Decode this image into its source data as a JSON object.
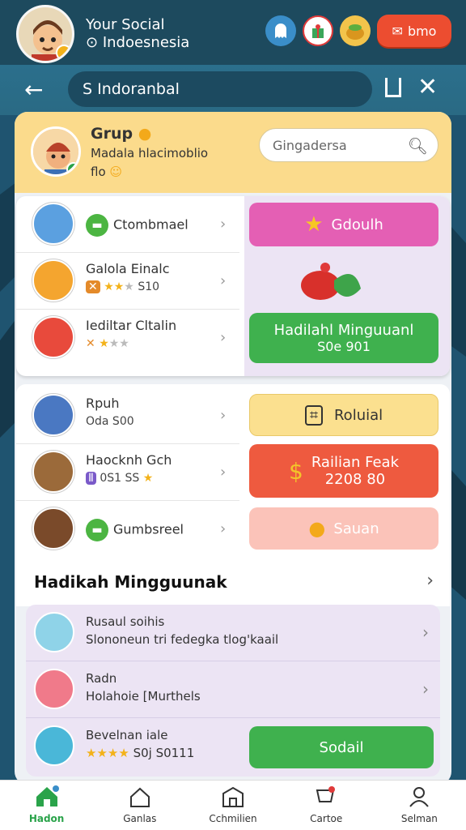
{
  "header": {
    "line1": "Your Social",
    "line2": "Indoesnesia",
    "action_label": "bmo"
  },
  "nav": {
    "search_value": "S Indoranbal"
  },
  "group": {
    "title": "Grup",
    "sub1": "Madala hlacimoblio",
    "sub2": "flo",
    "search_placeholder": "Gingadersa"
  },
  "list1": [
    {
      "t1": "Ctombmael",
      "t2": ""
    },
    {
      "t1": "Galola Einalc",
      "t2": "S10"
    },
    {
      "t1": "Iediltar Cltalin",
      "t2": ""
    }
  ],
  "side1": {
    "top_label": "Gdoulh",
    "bottom_line1": "Hadilahl Minguuanl",
    "bottom_line2": "S0e 901"
  },
  "list2": [
    {
      "t1": "Rpuh",
      "t2": "Oda S00"
    },
    {
      "t1": "Haocknh Gch",
      "t2": "0S1 SS"
    },
    {
      "t1": "Gumbsreel",
      "t2": ""
    }
  ],
  "side2": {
    "a_label": "Roluial",
    "b_line1": "Railian Feak",
    "b_line2": "2208 80",
    "c_label": "Sauan"
  },
  "weekly": {
    "title": "Hadikah Mingguunak",
    "rows": [
      {
        "t1": "Rusaul soihis",
        "t2": "Slononeun tri fedegka tlog'kaail"
      },
      {
        "t1": "Radn",
        "t2": "Holahoie [Murthels"
      },
      {
        "t1": "Bevelnan iale",
        "t2": "S0j S0111"
      }
    ],
    "social_label": "Sodail"
  },
  "bottom_nav": [
    {
      "label": "Hadon",
      "active": true
    },
    {
      "label": "Ganlas",
      "active": false
    },
    {
      "label": "Cchmilien",
      "active": false
    },
    {
      "label": "Cartoe",
      "active": false
    },
    {
      "label": "Selman",
      "active": false
    }
  ],
  "colors": {
    "header_bg": "#1d4a5e",
    "action_red": "#ec4d30",
    "group_card": "#fbdb8c",
    "pink_btn": "#e45fb4",
    "green_btn": "#3fb14e",
    "yellow_btn": "#fbe08f",
    "red_btn": "#ee5a3f",
    "peach_btn": "#fbc3b9"
  }
}
